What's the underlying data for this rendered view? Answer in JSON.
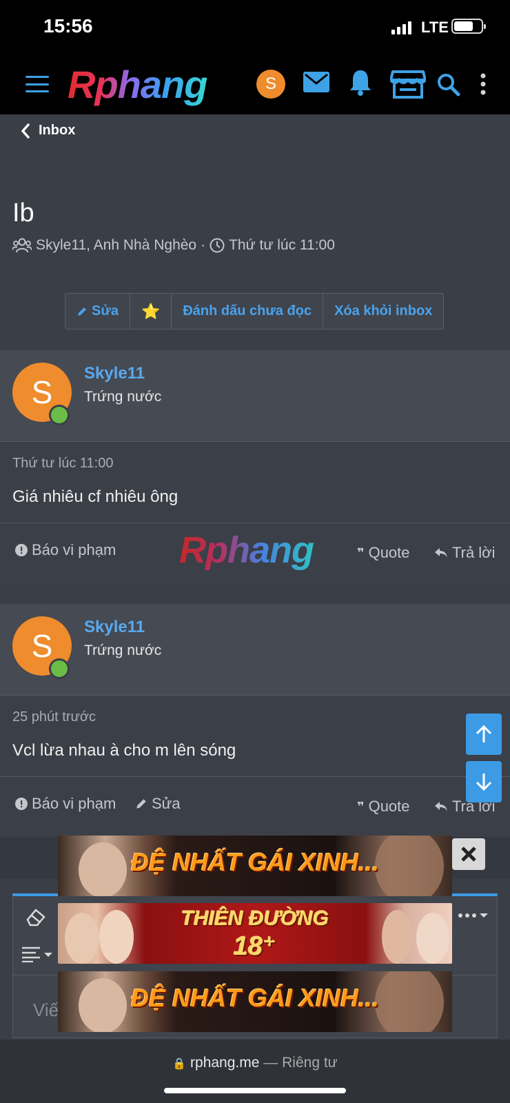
{
  "status_bar": {
    "time": "15:56",
    "network": "LTE"
  },
  "header": {
    "logo": "Rphang",
    "avatar_letter": "S"
  },
  "nav": {
    "back_label": "Inbox"
  },
  "conversation": {
    "title": "Ib",
    "participants": "Skyle11, Anh Nhà Nghèo",
    "separator": "·",
    "time": "Thứ tư lúc 11:00"
  },
  "actions": {
    "edit": "Sửa",
    "star": "⭐",
    "mark_unread": "Đánh dấu chưa đọc",
    "remove": "Xóa khỏi inbox"
  },
  "posts": [
    {
      "avatar_letter": "S",
      "username": "Skyle11",
      "rank": "Trứng nước",
      "time": "Thứ tư lúc 11:00",
      "body": "Giá nhiêu cf nhiêu ông",
      "report": "Báo vi phạm",
      "quote": "Quote",
      "reply": "Trả lời",
      "logo": "Rphang"
    },
    {
      "avatar_letter": "S",
      "username": "Skyle11",
      "rank": "Trứng nước",
      "time": "25 phút trước",
      "body": "Vcl lừa nhau à cho m lên sóng",
      "report": "Báo vi phạm",
      "edit": "Sửa",
      "quote": "Quote",
      "reply": "Trả lời"
    }
  ],
  "editor": {
    "placeholder": "Viế"
  },
  "ads": [
    {
      "text": "ĐỆ NHẤT GÁI XINH..."
    },
    {
      "text_line1": "THIÊN ĐƯỜNG",
      "text_line2": "18⁺"
    },
    {
      "text": "ĐỆ NHẤT GÁI XINH..."
    }
  ],
  "browser": {
    "domain": "rphang.me",
    "dash": "—",
    "privacy": "Riêng tư"
  },
  "colors": {
    "accent": "#3d9be6",
    "link": "#4aa3ed",
    "avatar": "#ef8c2d",
    "online": "#6bbd47"
  }
}
